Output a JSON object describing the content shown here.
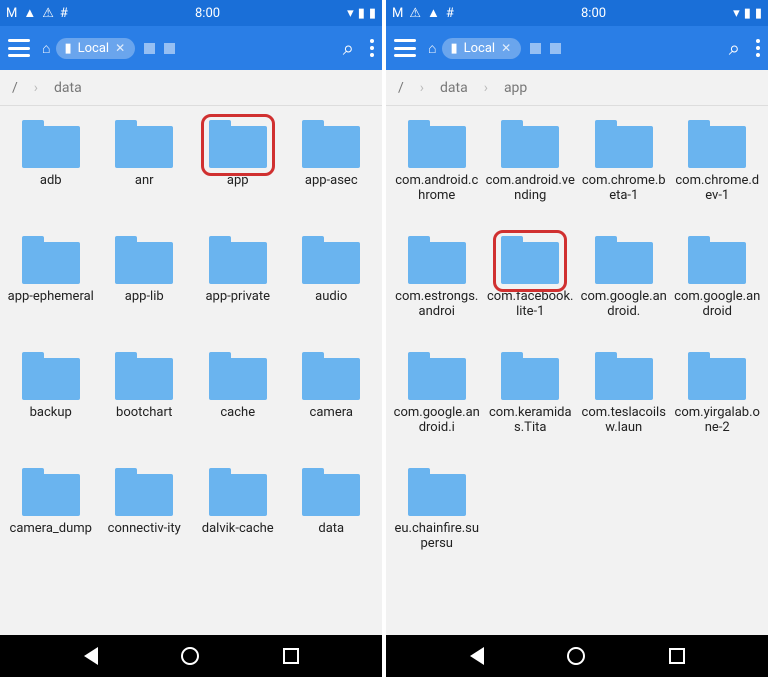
{
  "status": {
    "time": "8:00",
    "icons_left": [
      "M",
      "▲",
      "⚠",
      "#"
    ],
    "icons_right": [
      "▾",
      "▮",
      "▮"
    ]
  },
  "appbar": {
    "chip_label": "Local"
  },
  "left": {
    "breadcrumb": [
      "/",
      "data"
    ],
    "folders": [
      "adb",
      "anr",
      "app",
      "app-asec",
      "app-ephemeral",
      "app-lib",
      "app-private",
      "audio",
      "backup",
      "bootchart",
      "cache",
      "camera",
      "camera_dump",
      "connectiv-ity",
      "dalvik-cache",
      "data"
    ],
    "highlight_index": 2
  },
  "right": {
    "breadcrumb": [
      "/",
      "data",
      "app"
    ],
    "folders": [
      "com.android.chrome",
      "com.android.vending",
      "com.chrome.beta-1",
      "com.chrome.dev-1",
      "com.estrongs.androi",
      "com.facebook.lite-1",
      "com.google.android.",
      "com.google.android",
      "com.google.android.i",
      "com.keramidas.Tita",
      "com.teslacoilsw.laun",
      "com.yirgalab.one-2",
      "eu.chainfire.supersu"
    ],
    "highlight_index": 5
  }
}
